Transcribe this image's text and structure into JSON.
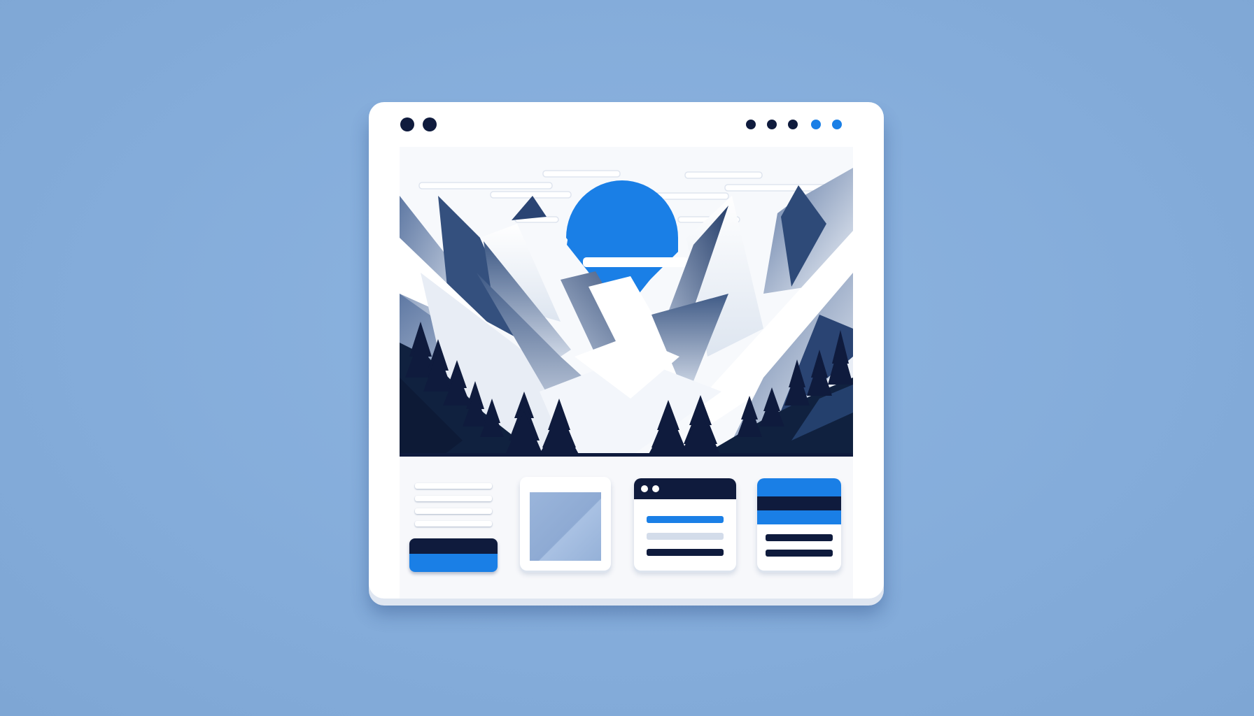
{
  "colors": {
    "background": "#86addb",
    "window": "#ffffff",
    "navy": "#0f1b3d",
    "accent_blue": "#1a7fe6",
    "light_line": "#d3dcea",
    "placeholder": "#8eaad3"
  },
  "window": {
    "titlebar_left_dots": [
      "navy",
      "navy"
    ],
    "titlebar_right_dots": [
      "navy",
      "navy",
      "navy",
      "accent_blue",
      "accent_blue"
    ]
  },
  "hero": {
    "icons": [
      "sun-icon",
      "mountain-range-illustration",
      "pine-tree-icon"
    ]
  },
  "cards": [
    {
      "name": "text-card",
      "icon": "text-lines-icon"
    },
    {
      "name": "image-card",
      "icon": "image-placeholder-icon"
    },
    {
      "name": "mini-window-card",
      "icon": "mini-window-icon"
    },
    {
      "name": "stripes-card",
      "icon": "stripes-icon"
    }
  ]
}
